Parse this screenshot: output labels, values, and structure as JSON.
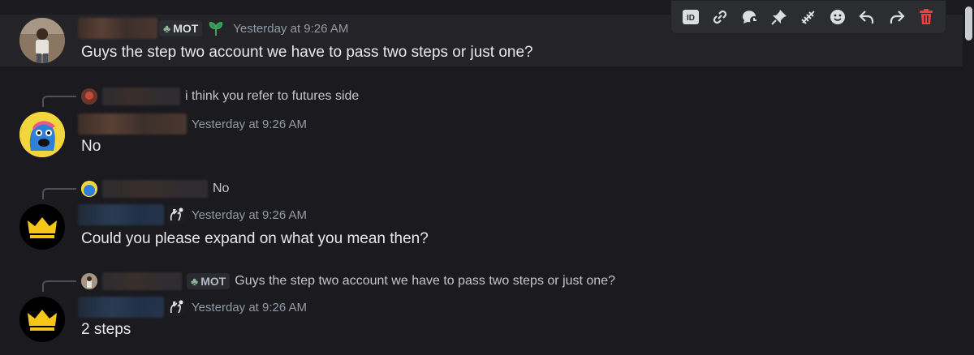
{
  "messages": [
    {
      "tag": "MOT",
      "timestamp": "Yesterday at 9:26 AM",
      "content": "Guys the step two account we have to pass two steps or just one?"
    },
    {
      "reply": {
        "text": "i think you refer to futures side"
      },
      "timestamp": "Yesterday at 9:26 AM",
      "content": "No"
    },
    {
      "reply": {
        "text": "No"
      },
      "timestamp": "Yesterday at 9:26 AM",
      "content": "Could you please expand on what you mean then?"
    },
    {
      "reply": {
        "tag": "MOT",
        "text": "Guys the step two account we have to pass two steps or just one?"
      },
      "timestamp": "Yesterday at 9:26 AM",
      "content": "2 steps"
    }
  ],
  "toolbar": {
    "icons": [
      "id-icon",
      "link-icon",
      "thread-icon",
      "pin-icon",
      "reaction-burst-icon",
      "emoji-icon",
      "reply-icon",
      "forward-icon",
      "delete-icon"
    ],
    "delete_color": "#f23f43"
  },
  "colors": {
    "background": "#1b1b1f",
    "hover_row": "#232328",
    "timestamp": "#949ba4"
  }
}
